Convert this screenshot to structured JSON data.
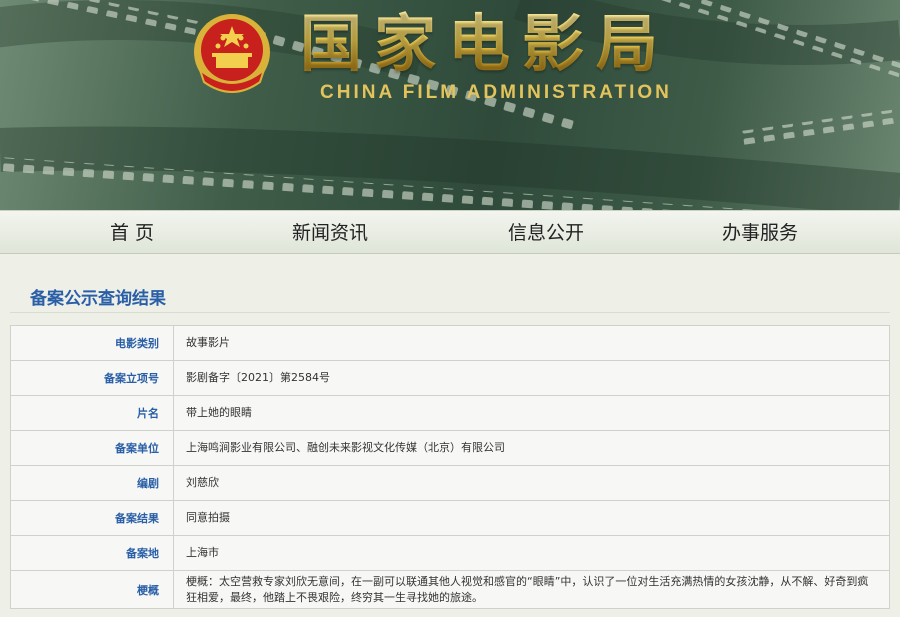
{
  "header": {
    "title_cn": "国家电影局",
    "title_en": "CHINA FILM ADMINISTRATION",
    "emblem": "national-emblem-icon"
  },
  "nav": {
    "items": [
      {
        "label": "首 页"
      },
      {
        "label": "新闻资讯"
      },
      {
        "label": "信息公开"
      },
      {
        "label": "办事服务"
      }
    ]
  },
  "main": {
    "section_title": "备案公示查询结果",
    "rows": [
      {
        "label": "电影类别",
        "value": "故事影片"
      },
      {
        "label": "备案立项号",
        "value": "影剧备字〔2021〕第2584号"
      },
      {
        "label": "片名",
        "value": "带上她的眼睛"
      },
      {
        "label": "备案单位",
        "value": "上海鸣涧影业有限公司、融创未来影视文化传媒（北京）有限公司"
      },
      {
        "label": "编剧",
        "value": "刘慈欣"
      },
      {
        "label": "备案结果",
        "value": "同意拍摄"
      },
      {
        "label": "备案地",
        "value": "上海市"
      },
      {
        "label": "梗概",
        "value": "梗概：太空营救专家刘欣无意间，在一副可以联通其他人视觉和感官的“眼睛”中，认识了一位对生活充满热情的女孩沈静，从不解、好奇到疯狂相爱，最终，他踏上不畏艰险，终穷其一生寻找她的旅途。"
      }
    ]
  },
  "colors": {
    "label_blue": "#2a5fa7",
    "gold": "#f0cf55",
    "banner_green": "#2f4a3a"
  }
}
